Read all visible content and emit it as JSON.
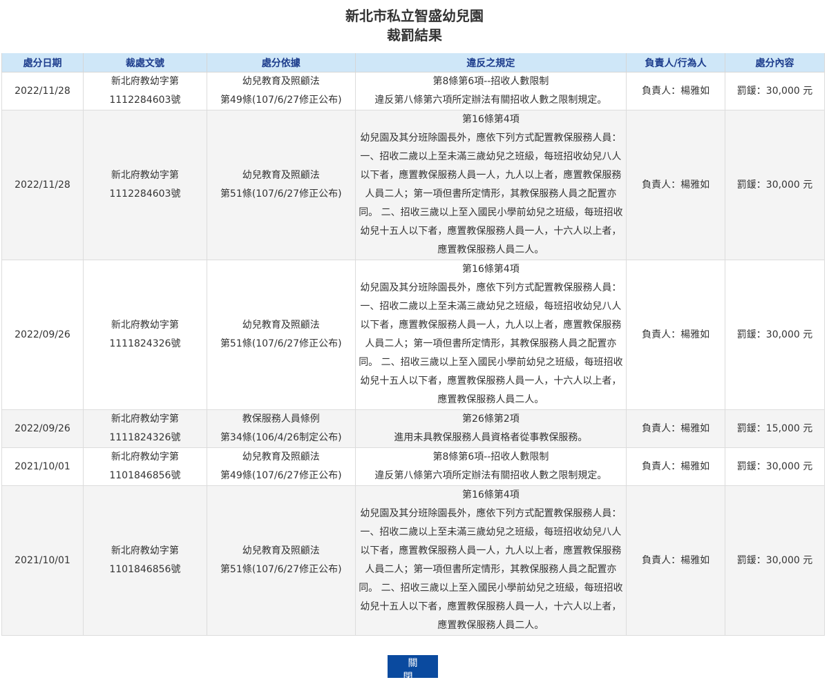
{
  "header": {
    "title": "新北市私立智盛幼兒園",
    "subtitle": "裁罰結果"
  },
  "table": {
    "columns": [
      "處分日期",
      "裁處文號",
      "處分依據",
      "違反之規定",
      "負責人/行為人",
      "處分內容"
    ],
    "rows": [
      {
        "date": "2022/11/28",
        "doc": [
          "新北府教幼字第",
          "1112284603號"
        ],
        "basis": [
          "幼兒教育及照顧法",
          "第49條(107/6/27修正公布)"
        ],
        "rule_title": "第8條第6項--招收人數限制",
        "rule_text": "違反第八條第六項所定辦法有關招收人數之限制規定。",
        "person": "負責人：楊雅如",
        "penalty": "罰鍰：30,000 元"
      },
      {
        "date": "2022/11/28",
        "doc": [
          "新北府教幼字第",
          "1112284603號"
        ],
        "basis": [
          "幼兒教育及照顧法",
          "第51條(107/6/27修正公布)"
        ],
        "rule_title": "第16條第4項",
        "rule_text": "幼兒園及其分班除園長外，應依下列方式配置教保服務人員： 一、招收二歲以上至未滿三歲幼兒之班級，每班招收幼兒八人以下者，應置教保服務人員一人，九人以上者，應置教保服務人員二人；第一項但書所定情形，其教保服務人員之配置亦同。 二、招收三歲以上至入國民小學前幼兒之班級，每班招收幼兒十五人以下者，應置教保服務人員一人，十六人以上者，應置教保服務人員二人。",
        "person": "負責人：楊雅如",
        "penalty": "罰鍰：30,000 元"
      },
      {
        "date": "2022/09/26",
        "doc": [
          "新北府教幼字第",
          "1111824326號"
        ],
        "basis": [
          "幼兒教育及照顧法",
          "第51條(107/6/27修正公布)"
        ],
        "rule_title": "第16條第4項",
        "rule_text": "幼兒園及其分班除園長外，應依下列方式配置教保服務人員： 一、招收二歲以上至未滿三歲幼兒之班級，每班招收幼兒八人以下者，應置教保服務人員一人，九人以上者，應置教保服務人員二人；第一項但書所定情形，其教保服務人員之配置亦同。 二、招收三歲以上至入國民小學前幼兒之班級，每班招收幼兒十五人以下者，應置教保服務人員一人，十六人以上者，應置教保服務人員二人。",
        "person": "負責人：楊雅如",
        "penalty": "罰鍰：30,000 元"
      },
      {
        "date": "2022/09/26",
        "doc": [
          "新北府教幼字第",
          "1111824326號"
        ],
        "basis": [
          "教保服務人員條例",
          "第34條(106/4/26制定公布)"
        ],
        "rule_title": "第26條第2項",
        "rule_text": "進用未具教保服務人員資格者從事教保服務。",
        "person": "負責人：楊雅如",
        "penalty": "罰鍰：15,000 元"
      },
      {
        "date": "2021/10/01",
        "doc": [
          "新北府教幼字第",
          "1101846856號"
        ],
        "basis": [
          "幼兒教育及照顧法",
          "第49條(107/6/27修正公布)"
        ],
        "rule_title": "第8條第6項--招收人數限制",
        "rule_text": "違反第八條第六項所定辦法有關招收人數之限制規定。",
        "person": "負責人：楊雅如",
        "penalty": "罰鍰：30,000 元"
      },
      {
        "date": "2021/10/01",
        "doc": [
          "新北府教幼字第",
          "1101846856號"
        ],
        "basis": [
          "幼兒教育及照顧法",
          "第51條(107/6/27修正公布)"
        ],
        "rule_title": "第16條第4項",
        "rule_text": "幼兒園及其分班除園長外，應依下列方式配置教保服務人員： 一、招收二歲以上至未滿三歲幼兒之班級，每班招收幼兒八人以下者，應置教保服務人員一人，九人以上者，應置教保服務人員二人；第一項但書所定情形，其教保服務人員之配置亦同。 二、招收三歲以上至入國民小學前幼兒之班級，每班招收幼兒十五人以下者，應置教保服務人員一人，十六人以上者，應置教保服務人員二人。",
        "person": "負責人：楊雅如",
        "penalty": "罰鍰：30,000 元"
      }
    ]
  },
  "footer": {
    "close_label": "關閉"
  },
  "colors": {
    "header_bg": "#cfe7f8",
    "header_text": "#1c3c8c",
    "button_bg": "#0a4a9f"
  }
}
